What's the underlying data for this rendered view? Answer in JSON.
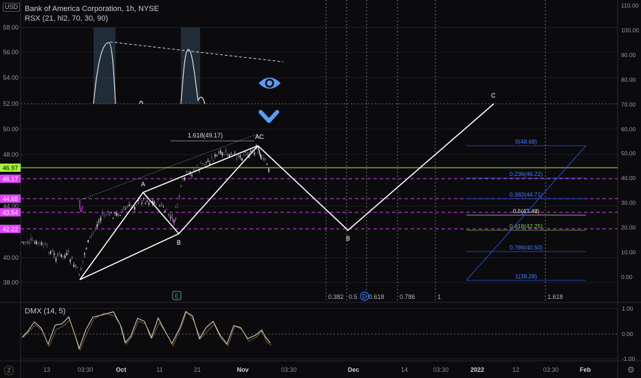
{
  "header": {
    "title": "Bank of America Corporation, 1h, NYSE",
    "indicator": "RSX (21, hl2, 70, 30, 90)",
    "currency": "USD",
    "dmx_label": "DMX (14, 5)"
  },
  "left_axis": {
    "ticks": [
      "58.00",
      "56.00",
      "54.00",
      "52.00",
      "50.00",
      "48.00",
      "44.00",
      "40.00",
      "38.00"
    ],
    "badges": [
      {
        "label": "46.97",
        "color": "#a4f53a",
        "text_color": "#000000"
      },
      {
        "label": "46.17",
        "color": "#e040fb",
        "text_color": "#ffffff"
      },
      {
        "label": "44.65",
        "color": "#e040fb",
        "text_color": "#ffffff"
      },
      {
        "label": "43.54",
        "color": "#e040fb",
        "text_color": "#ffffff"
      },
      {
        "label": "42.22",
        "color": "#e040fb",
        "text_color": "#ffffff"
      }
    ]
  },
  "right_axis": {
    "ticks": [
      "110.00",
      "100.00",
      "90.00",
      "80.00",
      "70.00",
      "60.00",
      "50.00",
      "40.00",
      "30.00",
      "20.00",
      "10.00",
      "0.00"
    ],
    "dmx_ticks": [
      "1.00",
      "0.00",
      "-1.00"
    ]
  },
  "time_axis": {
    "labels": [
      "13",
      "03:30",
      "Oct",
      "11",
      "21",
      "Nov",
      "03:30",
      "Dec",
      "14",
      "03:30",
      "2022",
      "12",
      "03:30",
      "Feb"
    ],
    "bold": [
      "Oct",
      "Nov",
      "Dec",
      "2022",
      "Feb"
    ]
  },
  "wave_labels": {
    "a1": "A",
    "b1": "B",
    "c1": "AC",
    "b2": "B",
    "c2": "C"
  },
  "fib_ext": {
    "label": "1.618(49.17)",
    "bottom_labels": [
      "0.382",
      "0.5",
      "0.618",
      "0.786",
      "1",
      "1.618"
    ]
  },
  "fib_retracement": {
    "levels": [
      {
        "label": "0(48.68)",
        "color": "#2962ff"
      },
      {
        "label": "0.236(46.22)",
        "color": "#2962ff"
      },
      {
        "label": "0.382(44.71)",
        "color": "#2962ff"
      },
      {
        "label": "0.5(43.48)",
        "color": "#e6e6e6"
      },
      {
        "label": "0.618(42.25)",
        "color": "#7cd14a"
      },
      {
        "label": "0.786(40.50)",
        "color": "#2962ff"
      },
      {
        "label": "1(38.28)",
        "color": "#2962ff"
      }
    ]
  },
  "earnings_marker": "E",
  "dividend_marker": "D",
  "colors": {
    "background": "#0b0b0e",
    "wave": "#ffffff",
    "magenta": "#e040fb",
    "lime": "#a4f53a",
    "fib_blue": "#2962ff",
    "accent_blue": "#5b9cf0"
  },
  "icons": {
    "eye": "eye-icon",
    "chevron": "chevron-down-icon",
    "settings": "gear-icon"
  }
}
